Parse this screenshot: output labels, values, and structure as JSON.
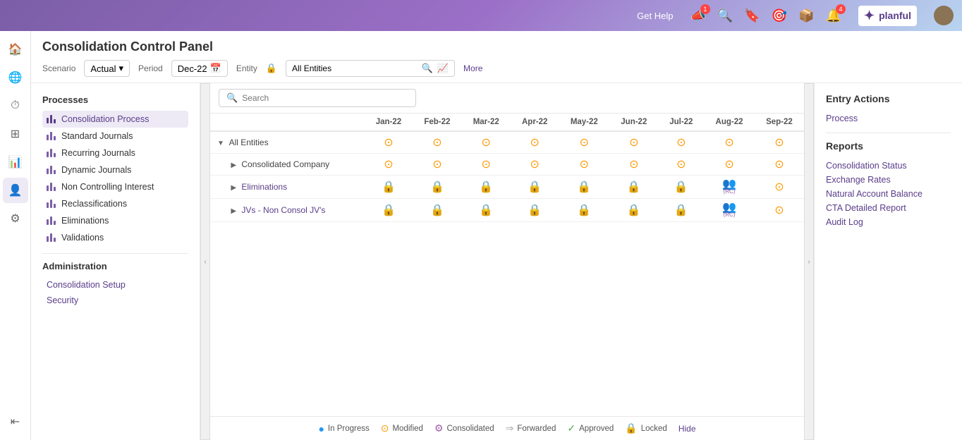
{
  "topnav": {
    "get_help": "Get Help",
    "notification_count": "4",
    "announcement_count": "1",
    "logo_text": "planful"
  },
  "page": {
    "title": "Consolidation Control Panel"
  },
  "filters": {
    "scenario_label": "Scenario",
    "scenario_value": "Actual",
    "period_label": "Period",
    "period_value": "Dec-22",
    "entity_label": "Entity",
    "entity_value": "All Entities",
    "entity_placeholder": "All Entities",
    "more_label": "More"
  },
  "search": {
    "placeholder": "Search"
  },
  "processes": {
    "section_title": "Processes",
    "items": [
      {
        "id": "consolidation-process",
        "label": "Consolidation Process",
        "active": true
      },
      {
        "id": "standard-journals",
        "label": "Standard Journals",
        "active": false
      },
      {
        "id": "recurring-journals",
        "label": "Recurring Journals",
        "active": false
      },
      {
        "id": "dynamic-journals",
        "label": "Dynamic Journals",
        "active": false
      },
      {
        "id": "non-controlling-interest",
        "label": "Non Controlling Interest",
        "active": false
      },
      {
        "id": "reclassifications",
        "label": "Reclassifications",
        "active": false
      },
      {
        "id": "eliminations",
        "label": "Eliminations",
        "active": false
      },
      {
        "id": "validations",
        "label": "Validations",
        "active": false
      }
    ]
  },
  "administration": {
    "section_title": "Administration",
    "links": [
      {
        "id": "consolidation-setup",
        "label": "Consolidation Setup"
      },
      {
        "id": "security",
        "label": "Security"
      }
    ]
  },
  "grid": {
    "columns": [
      "",
      "Jan-22",
      "Feb-22",
      "Mar-22",
      "Apr-22",
      "May-22",
      "Jun-22",
      "Jul-22",
      "Aug-22",
      "Sep-22"
    ],
    "rows": [
      {
        "id": "all-entities",
        "name": "All Entities",
        "expandable": true,
        "expanded": true,
        "indent": 0,
        "statuses": [
          "inprogress",
          "inprogress",
          "inprogress",
          "inprogress",
          "inprogress",
          "inprogress",
          "inprogress",
          "inprogress",
          "inprogress"
        ]
      },
      {
        "id": "consolidated-company",
        "name": "Consolidated Company",
        "expandable": true,
        "expanded": false,
        "indent": 1,
        "statuses": [
          "inprogress",
          "inprogress",
          "inprogress",
          "inprogress",
          "inprogress",
          "inprogress",
          "inprogress",
          "inprogress",
          "inprogress"
        ]
      },
      {
        "id": "eliminations",
        "name": "Eliminations",
        "expandable": true,
        "expanded": false,
        "indent": 1,
        "isLink": true,
        "statuses": [
          "locked",
          "locked",
          "locked",
          "locked",
          "locked",
          "locked",
          "locked",
          "rc",
          "inprogress"
        ]
      },
      {
        "id": "jvs",
        "name": "JVs - Non Consol JV's",
        "expandable": true,
        "expanded": false,
        "indent": 1,
        "isLink": true,
        "statuses": [
          "locked",
          "locked",
          "locked",
          "locked",
          "locked",
          "locked",
          "locked",
          "rc",
          "inprogress"
        ]
      }
    ]
  },
  "entry_actions": {
    "title": "Entry Actions",
    "process_label": "Process"
  },
  "reports": {
    "title": "Reports",
    "items": [
      {
        "id": "consolidation-status",
        "label": "Consolidation Status"
      },
      {
        "id": "exchange-rates",
        "label": "Exchange Rates"
      },
      {
        "id": "natural-account-balance",
        "label": "Natural Account Balance"
      },
      {
        "id": "cta-detailed-report",
        "label": "CTA Detailed Report"
      },
      {
        "id": "audit-log",
        "label": "Audit Log"
      }
    ]
  },
  "legend": {
    "items": [
      {
        "id": "in-progress",
        "icon": "●",
        "color_class": "inprogress",
        "label": "In Progress"
      },
      {
        "id": "modified",
        "icon": "⊙",
        "color_class": "modified",
        "label": "Modified"
      },
      {
        "id": "consolidated",
        "icon": "⚙",
        "color_class": "consolidated",
        "label": "Consolidated"
      },
      {
        "id": "forwarded",
        "icon": "⇒",
        "color_class": "forwarded",
        "label": "Forwarded"
      },
      {
        "id": "approved",
        "icon": "✓",
        "color_class": "approved",
        "label": "Approved"
      },
      {
        "id": "locked",
        "icon": "🔒",
        "color_class": "locked",
        "label": "Locked"
      }
    ],
    "hide_label": "Hide"
  }
}
